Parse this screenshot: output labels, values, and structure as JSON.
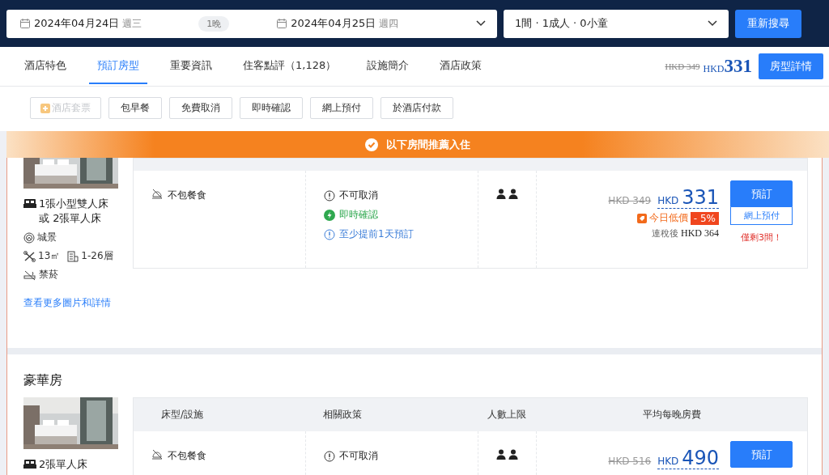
{
  "search": {
    "check_in": {
      "date": "2024年04月24日",
      "weekday": "週三"
    },
    "nights": "1晚",
    "check_out": {
      "date": "2024年04月25日",
      "weekday": "週四"
    },
    "guests": "1間 · 1成人 · 0小童",
    "button": "重新搜尋"
  },
  "tabs": [
    {
      "label": "酒店特色",
      "selected": false
    },
    {
      "label": "預訂房型",
      "selected": true
    },
    {
      "label": "重要資訊",
      "selected": false
    },
    {
      "label": "住客點評（1,128）",
      "selected": false
    },
    {
      "label": "設施簡介",
      "selected": false
    },
    {
      "label": "酒店政策",
      "selected": false
    }
  ],
  "price_summary": {
    "original": "HKD 349",
    "currency": "HKD",
    "price": "331",
    "button": "房型詳情"
  },
  "filters": [
    {
      "label": "酒店套票",
      "disabled": true
    },
    {
      "label": "包早餐",
      "disabled": false
    },
    {
      "label": "免費取消",
      "disabled": false
    },
    {
      "label": "即時確認",
      "disabled": false
    },
    {
      "label": "網上預付",
      "disabled": false
    },
    {
      "label": "於酒店付款",
      "disabled": false
    }
  ],
  "banner": "以下房間推薦入住",
  "rooms": [
    {
      "features": [
        {
          "kind": "bed",
          "text": "1張小型雙人床或 2張單人床"
        },
        {
          "kind": "view",
          "text": "城景"
        },
        {
          "kind": "size",
          "text": "13㎡"
        },
        {
          "kind": "floor",
          "text": "1-26層"
        },
        {
          "kind": "smoking",
          "text": "禁菸"
        }
      ],
      "link": "查看更多圖片和詳情",
      "rate": {
        "meal": "不包餐食",
        "policies": [
          {
            "kind": "warning",
            "text": "不可取消"
          },
          {
            "kind": "instant",
            "text": "即時確認"
          },
          {
            "kind": "info",
            "text": "至少提前1天預訂"
          }
        ],
        "price_original": "HKD 349",
        "currency": "HKD",
        "price": "331",
        "deal": "今日低價",
        "discount": "- 5%",
        "tax_label": "連稅後",
        "tax_price": "HKD 364",
        "book_button": "預訂",
        "payment": "網上預付",
        "remaining": "僅剩3間！"
      }
    },
    {
      "name": "豪華房",
      "columns": [
        "床型/設施",
        "相關政策",
        "人數上限",
        "平均每晚房費"
      ],
      "features": [
        {
          "kind": "bed",
          "text": "2張單人床"
        }
      ],
      "rate": {
        "meal": "不包餐食",
        "policies": [
          {
            "kind": "warning",
            "text": "不可取消"
          }
        ],
        "price_original": "HKD 516",
        "currency": "HKD",
        "price": "490",
        "book_button": "預訂"
      }
    }
  ]
}
